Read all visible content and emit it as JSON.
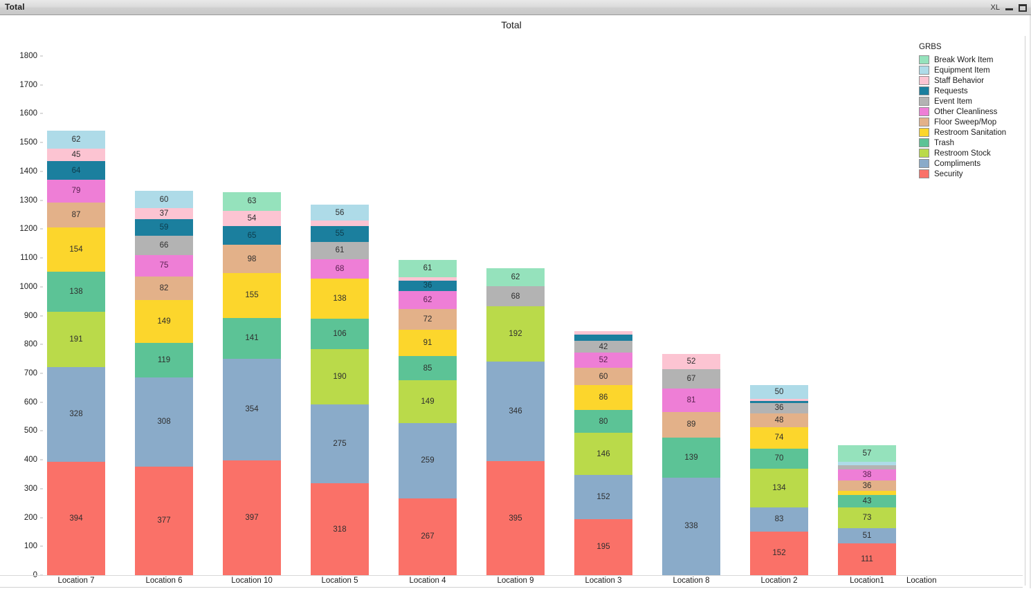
{
  "window": {
    "title": "Total",
    "controls": {
      "xl_label": "XL",
      "minimize": "minimize-button",
      "maximize": "maximize-button"
    }
  },
  "chart_data": {
    "type": "bar",
    "subtype": "stacked-vertical",
    "title": "Total",
    "xlabel": "Location",
    "ylabel": "",
    "ylim": [
      0,
      1800
    ],
    "ytick_step": 100,
    "yticks": [
      0,
      100,
      200,
      300,
      400,
      500,
      600,
      700,
      800,
      900,
      1000,
      1100,
      1200,
      1300,
      1400,
      1500,
      1600,
      1700,
      1800
    ],
    "grid": false,
    "legend_position": "right",
    "legend_title": "GRBS",
    "categories": [
      "Location 7",
      "Location 6",
      "Location 10",
      "Location 5",
      "Location 4",
      "Location 9",
      "Location 3",
      "Location 8",
      "Location 2",
      "Location1"
    ],
    "series": [
      {
        "name": "Break Work Item",
        "color": "#95e2bc",
        "values": [
          0,
          0,
          63,
          0,
          61,
          62,
          0,
          0,
          0,
          57
        ]
      },
      {
        "name": "Equipment Item",
        "color": "#aedbe8",
        "values": [
          62,
          60,
          0,
          56,
          0,
          0,
          0,
          0,
          50,
          13
        ]
      },
      {
        "name": "Staff Behavior",
        "color": "#fcc4d2",
        "values": [
          45,
          37,
          54,
          18,
          12,
          0,
          10,
          52,
          7,
          0
        ]
      },
      {
        "name": "Requests",
        "color": "#1b7f9e",
        "values": [
          64,
          59,
          65,
          55,
          36,
          0,
          22,
          0,
          6,
          0
        ]
      },
      {
        "name": "Event Item",
        "color": "#b3b3b3",
        "values": [
          0,
          66,
          0,
          61,
          0,
          68,
          42,
          67,
          36,
          14
        ]
      },
      {
        "name": "Other Cleanliness",
        "color": "#ee7ed6",
        "values": [
          79,
          75,
          0,
          68,
          62,
          0,
          52,
          81,
          0,
          38
        ]
      },
      {
        "name": "Floor Sweep/Mop",
        "color": "#e3b189",
        "values": [
          87,
          82,
          98,
          0,
          72,
          0,
          60,
          89,
          48,
          36
        ]
      },
      {
        "name": "Restroom Sanitation",
        "color": "#fcd62c",
        "values": [
          154,
          149,
          155,
          138,
          91,
          0,
          86,
          0,
          74,
          14
        ]
      },
      {
        "name": "Trash",
        "color": "#5cc396",
        "values": [
          138,
          119,
          141,
          106,
          85,
          0,
          80,
          139,
          70,
          43
        ]
      },
      {
        "name": "Restroom Stock",
        "color": "#bada4a",
        "values": [
          191,
          0,
          0,
          190,
          149,
          192,
          146,
          0,
          134,
          73
        ]
      },
      {
        "name": "Compliments",
        "color": "#8aabc9",
        "values": [
          328,
          308,
          354,
          275,
          259,
          346,
          152,
          338,
          83,
          51
        ]
      },
      {
        "name": "Security",
        "color": "#fa7168",
        "values": [
          394,
          377,
          397,
          318,
          267,
          395,
          195,
          0,
          152,
          111
        ]
      }
    ],
    "unlabeled_segments_note": "Segments too thin to display a value label are rendered without text",
    "visible_value_labels": {
      "Location 7": {
        "Equipment Item": 62,
        "Staff Behavior": 45,
        "Requests": 64,
        "Other Cleanliness": 79,
        "Floor Sweep/Mop": 87,
        "Restroom Sanitation": 154,
        "Trash": 138,
        "Restroom Stock": 191,
        "Compliments": 328,
        "Security": 394
      },
      "Location 6": {
        "Equipment Item": 60,
        "Staff Behavior": 37,
        "Requests": 59,
        "Event Item": 66,
        "Other Cleanliness": 75,
        "Floor Sweep/Mop": 82,
        "Restroom Sanitation": 149,
        "Trash": 119,
        "Compliments": 308,
        "Security": 377
      },
      "Location 10": {
        "Break Work Item": 63,
        "Staff Behavior": 54,
        "Requests": 65,
        "Floor Sweep/Mop": 98,
        "Restroom Sanitation": 155,
        "Trash": 141,
        "Compliments": 354,
        "Security": 397
      },
      "Location 5": {
        "Equipment Item": 56,
        "Requests": 55,
        "Event Item": 61,
        "Other Cleanliness": 68,
        "Restroom Sanitation": 138,
        "Trash": 106,
        "Restroom Stock": 190,
        "Compliments": 275,
        "Security": 318
      },
      "Location 4": {
        "Break Work Item": 61,
        "Requests": 36,
        "Other Cleanliness": 62,
        "Floor Sweep/Mop": 72,
        "Restroom Sanitation": 91,
        "Trash": 85,
        "Restroom Stock": 149,
        "Compliments": 259,
        "Security": 267
      },
      "Location 9": {
        "Break Work Item": 62,
        "Event Item": 68,
        "Restroom Stock": 192,
        "Compliments": 346,
        "Security": 395
      },
      "Location 3": {
        "Event Item": 42,
        "Other Cleanliness": 52,
        "Floor Sweep/Mop": 60,
        "Restroom Sanitation": 86,
        "Trash": 80,
        "Restroom Stock": 146,
        "Compliments": 152,
        "Security": 195
      },
      "Location 8": {
        "Staff Behavior": 52,
        "Event Item": 67,
        "Other Cleanliness": 81,
        "Floor Sweep/Mop": 89,
        "Trash": 139,
        "Compliments": 338
      },
      "Location 2": {
        "Equipment Item": 50,
        "Event Item": 36,
        "Floor Sweep/Mop": 48,
        "Restroom Sanitation": 74,
        "Trash": 70,
        "Restroom Stock": 134,
        "Compliments": 83,
        "Security": 152
      },
      "Location1": {
        "Break Work Item": 57,
        "Other Cleanliness": 38,
        "Floor Sweep/Mop": 36,
        "Trash": 43,
        "Restroom Stock": 73,
        "Compliments": 51,
        "Security": 111
      }
    }
  }
}
